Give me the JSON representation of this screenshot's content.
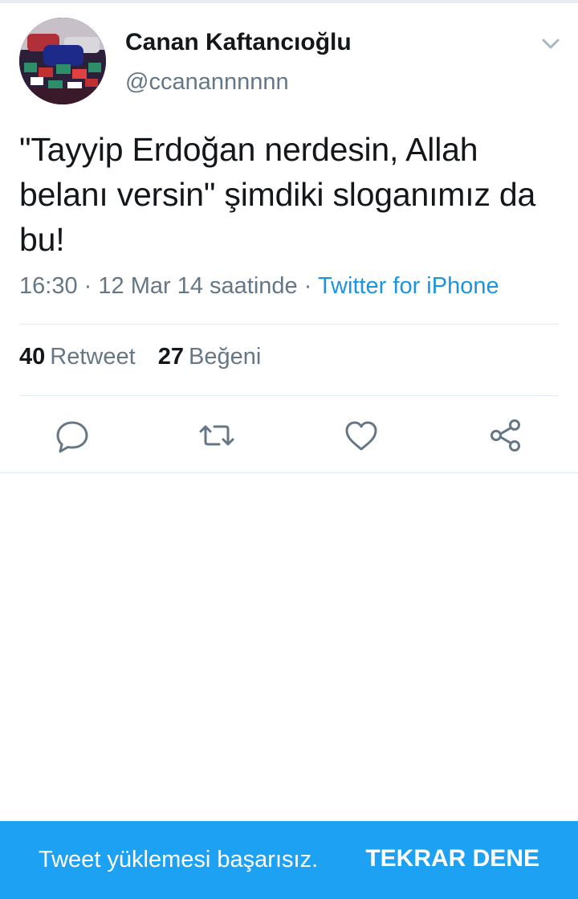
{
  "author": {
    "display_name": "Canan Kaftancıoğlu",
    "handle": "@ccanannnnnn",
    "avatar_icon": "profile-photo"
  },
  "header": {
    "menu_icon": "chevron-down-icon"
  },
  "tweet": {
    "text": "\"Tayyip Erdoğan nerdesin, Allah belanı versin\" şimdiki sloganımız da bu!",
    "time": "16:30",
    "date_text": "12 Mar 14 saatinde",
    "separator": "·",
    "source": "Twitter for iPhone"
  },
  "stats": {
    "retweets_count": "40",
    "retweets_label": "Retweet",
    "likes_count": "27",
    "likes_label": "Beğeni"
  },
  "actions": {
    "reply_icon": "reply-icon",
    "retweet_icon": "retweet-icon",
    "like_icon": "heart-icon",
    "share_icon": "share-icon"
  },
  "snackbar": {
    "message": "Tweet yüklemesi başarısız.",
    "action_label": "TEKRAR DENE"
  },
  "colors": {
    "accent": "#1da1f2",
    "link": "#1b95e0",
    "secondary_text": "#657786",
    "divider": "#e1e8ed"
  }
}
